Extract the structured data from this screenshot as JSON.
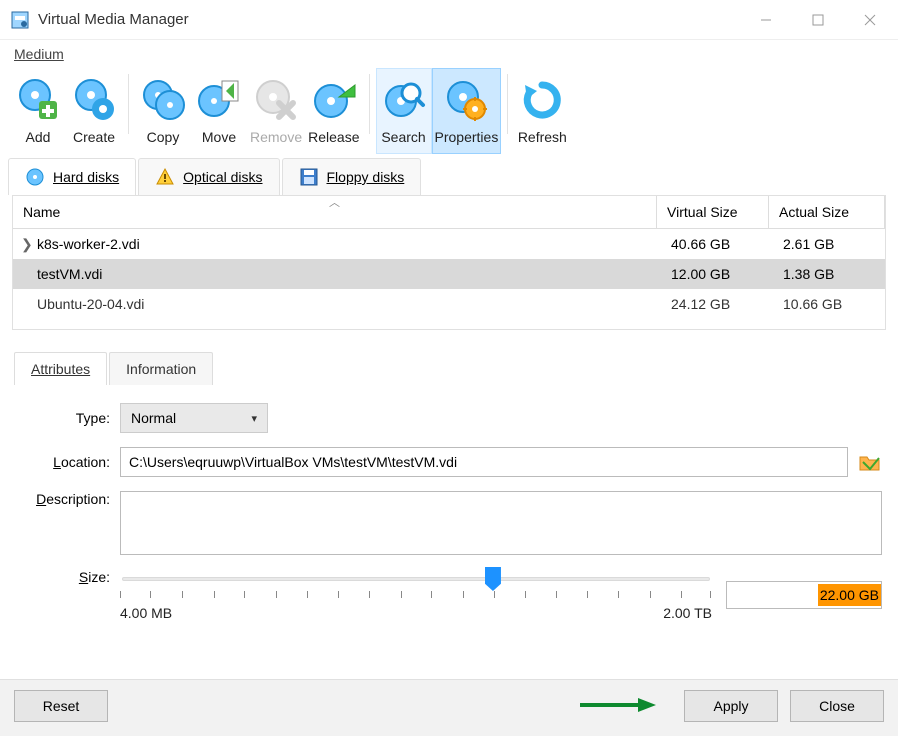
{
  "window": {
    "title": "Virtual Media Manager"
  },
  "menu": {
    "medium": "Medium"
  },
  "toolbar": {
    "add": "Add",
    "create": "Create",
    "copy": "Copy",
    "move": "Move",
    "remove": "Remove",
    "release": "Release",
    "search": "Search",
    "properties": "Properties",
    "refresh": "Refresh"
  },
  "disktabs": {
    "hard": "Hard disks",
    "optical": "Optical disks",
    "floppy": "Floppy disks"
  },
  "columns": {
    "name": "Name",
    "vsize": "Virtual Size",
    "asize": "Actual Size"
  },
  "rows": [
    {
      "name": "k8s-worker-2.vdi",
      "vsize": "40.66 GB",
      "asize": "2.61 GB"
    },
    {
      "name": "testVM.vdi",
      "vsize": "12.00 GB",
      "asize": "1.38 GB"
    },
    {
      "name": "Ubuntu-20-04.vdi",
      "vsize": "24.12 GB",
      "asize": "10.66 GB"
    }
  ],
  "detailtabs": {
    "attributes": "Attributes",
    "information": "Information"
  },
  "form": {
    "type_label": "Type:",
    "type_value": "Normal",
    "location_label": "Location:",
    "location_value": "C:\\Users\\eqruuwp\\VirtualBox VMs\\testVM\\testVM.vdi",
    "description_label": "Description:",
    "size_label": "Size:",
    "size_min": "4.00 MB",
    "size_max": "2.00 TB",
    "size_value": "22.00 GB"
  },
  "buttons": {
    "reset": "Reset",
    "apply": "Apply",
    "close": "Close"
  }
}
